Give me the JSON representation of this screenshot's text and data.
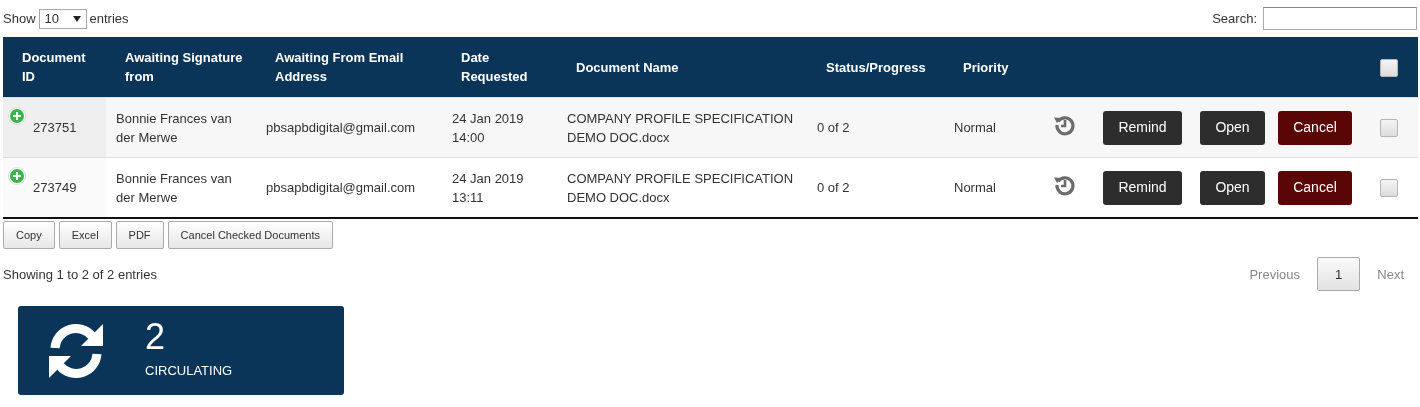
{
  "length_menu": {
    "label_before": "Show",
    "value": "10",
    "label_after": "entries"
  },
  "search": {
    "label": "Search:"
  },
  "table": {
    "columns": [
      "Document ID",
      "Awaiting Signature from",
      "Awaiting From Email Address",
      "Date Requested",
      "Document Name",
      "Status/Progress",
      "Priority"
    ],
    "select_all": {
      "checked": false
    },
    "rows": [
      {
        "document_id": "273751",
        "awaiting_signature_from": "Bonnie Frances van der Merwe",
        "email": "pbsapbdigital@gmail.com",
        "date_requested": "24 Jan 2019 14:00",
        "document_name": "COMPANY PROFILE SPECIFICATION DEMO DOC.docx",
        "status": "0 of 2",
        "priority": "Normal",
        "actions": [
          {
            "label": "Remind",
            "kind": "remind"
          },
          {
            "label": "Open",
            "kind": "open"
          },
          {
            "label": "Cancel",
            "kind": "cancel"
          }
        ],
        "checked": false
      },
      {
        "document_id": "273749",
        "awaiting_signature_from": "Bonnie Frances van der Merwe",
        "email": "pbsapbdigital@gmail.com",
        "date_requested": "24 Jan 2019 13:11",
        "document_name": "COMPANY PROFILE SPECIFICATION DEMO DOC.docx",
        "status": "0 of 2",
        "priority": "Normal",
        "actions": [
          {
            "label": "Remind",
            "kind": "remind"
          },
          {
            "label": "Open",
            "kind": "open"
          },
          {
            "label": "Cancel",
            "kind": "cancel"
          }
        ],
        "checked": false
      }
    ]
  },
  "export_buttons": [
    "Copy",
    "Excel",
    "PDF",
    "Cancel Checked Documents"
  ],
  "info": "Showing 1 to 2 of 2 entries",
  "pagination": {
    "previous": {
      "label": "Previous",
      "disabled": true
    },
    "pages": [
      {
        "label": "1",
        "selected": true
      }
    ],
    "next": {
      "label": "Next",
      "disabled": true
    }
  },
  "stat_tile": {
    "count": "2",
    "label": "CIRCULATING"
  }
}
